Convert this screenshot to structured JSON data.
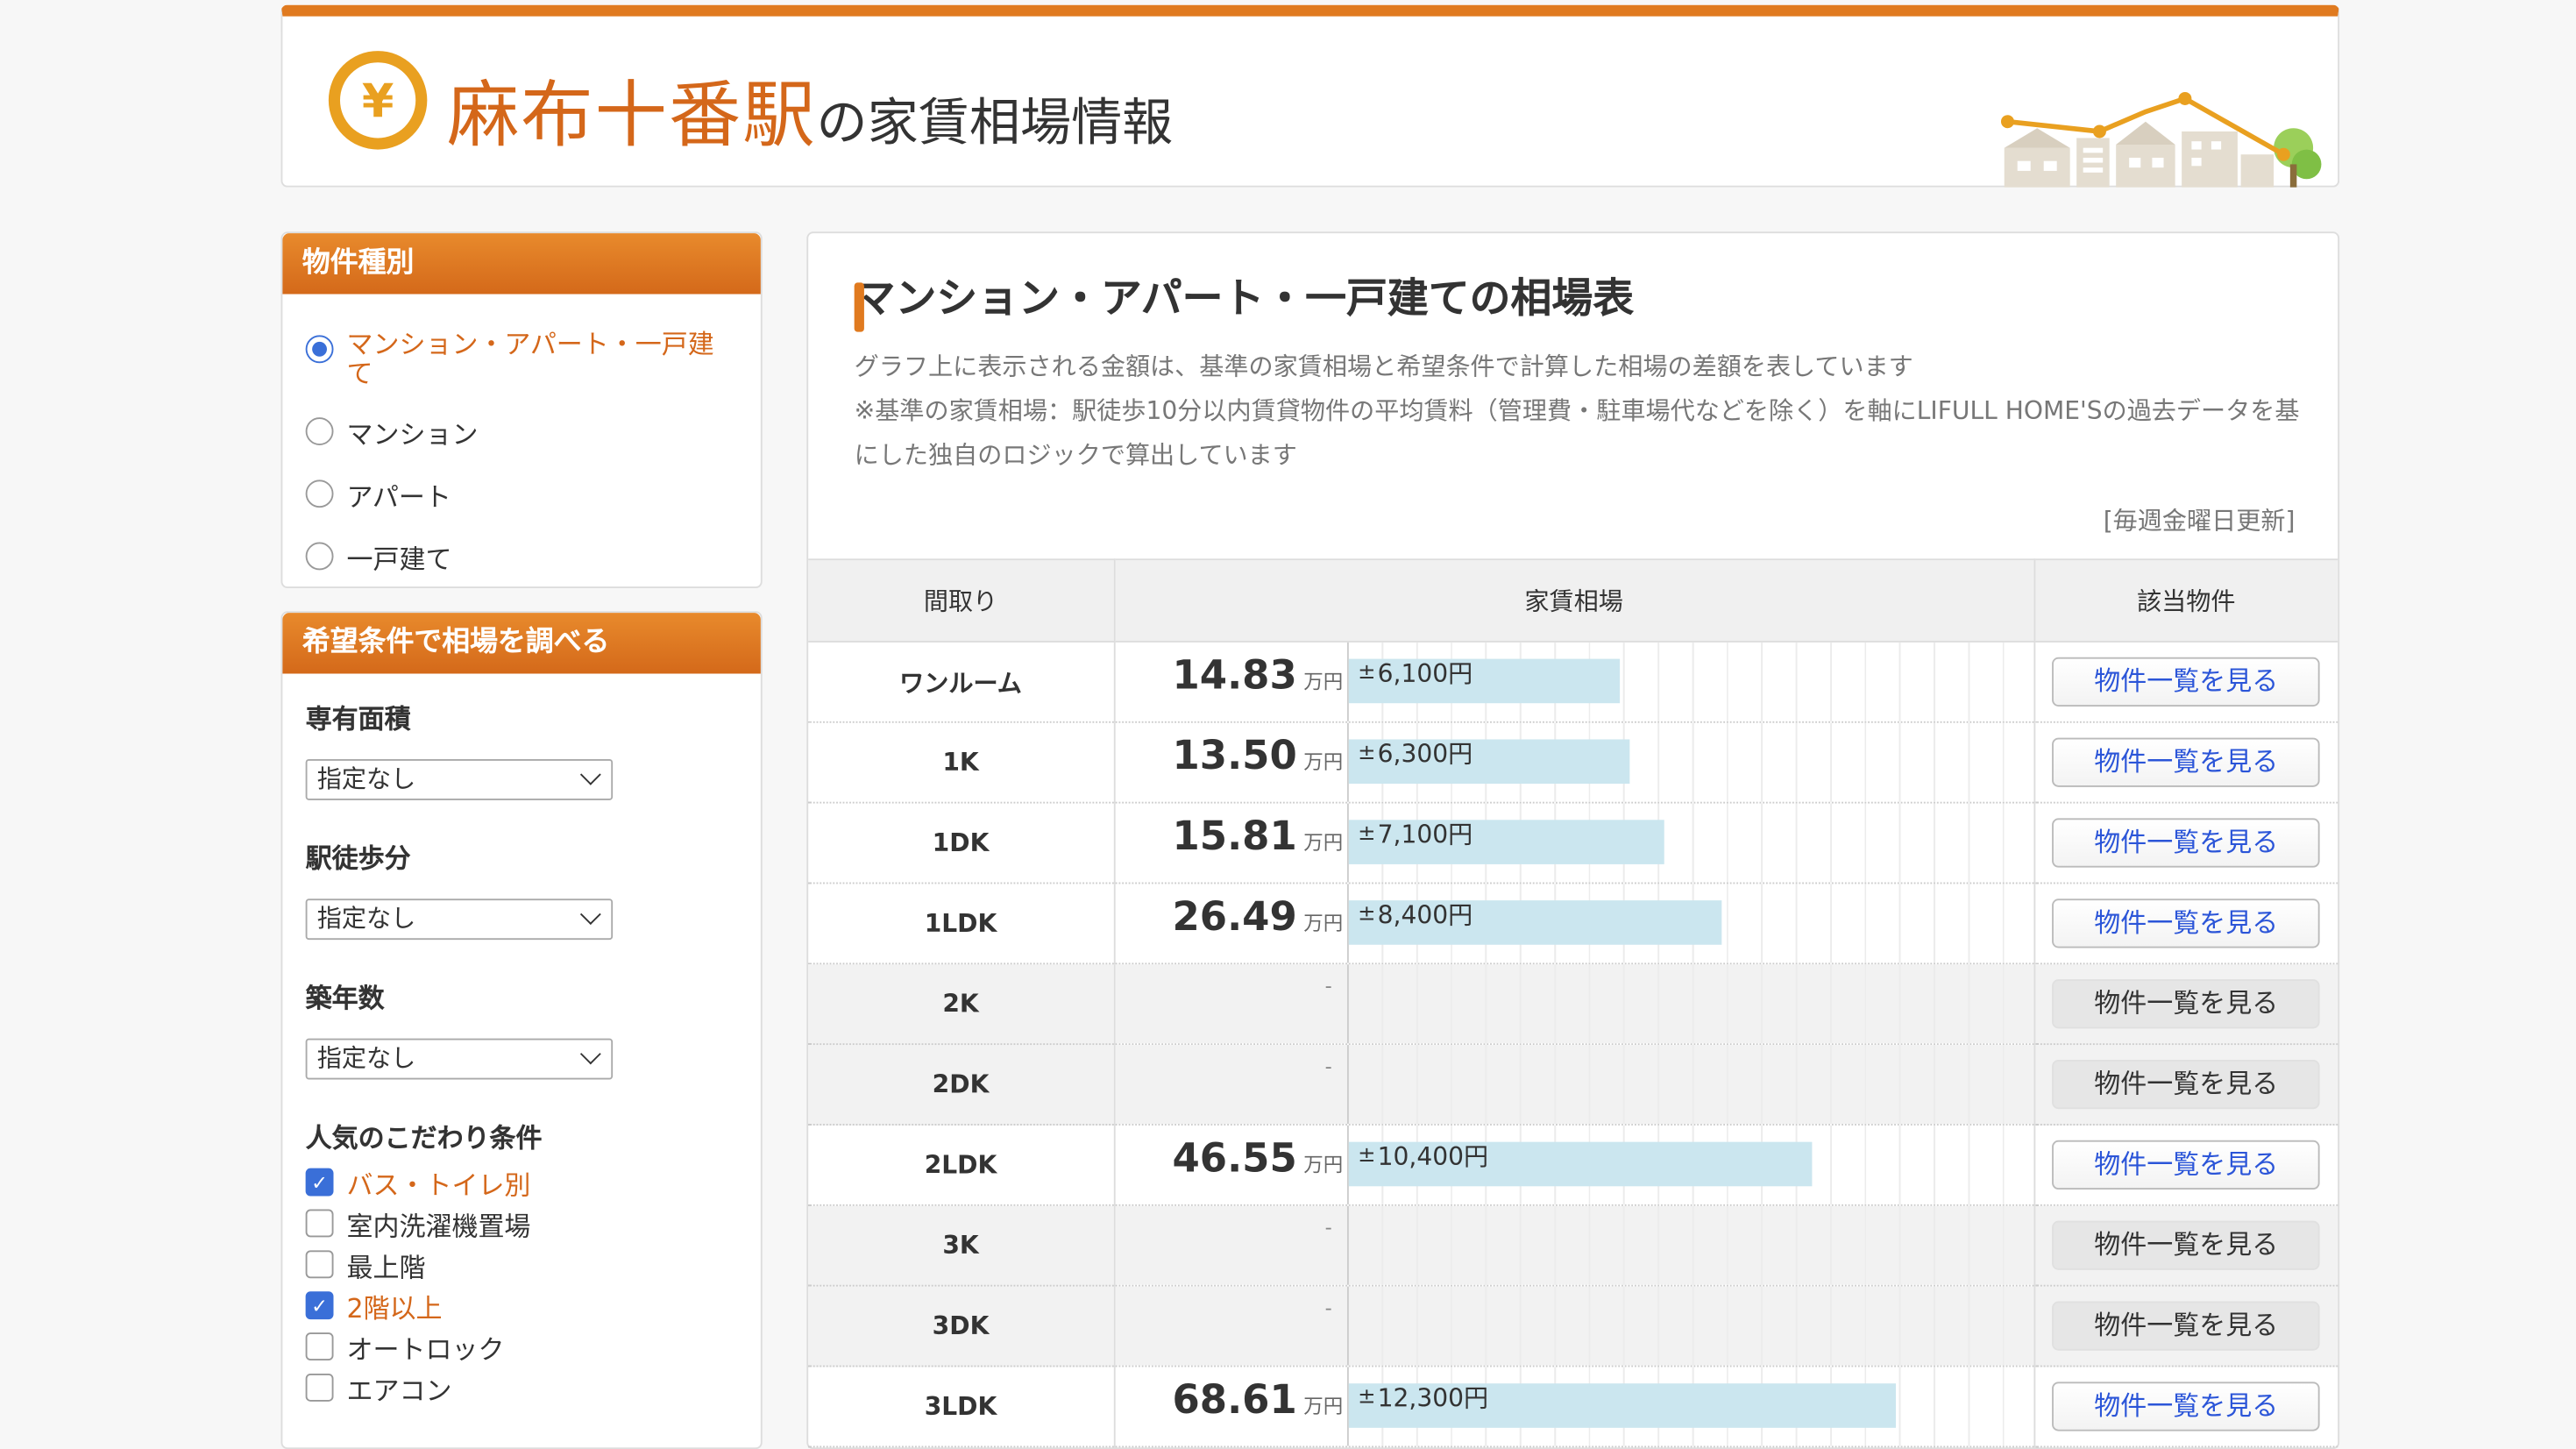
{
  "header": {
    "station": "麻布十番駅",
    "suffix": "の家賃相場情報",
    "logo_icon": "yen-coin-icon",
    "accent_color": "#e07a1f"
  },
  "property_type": {
    "heading": "物件種別",
    "options": [
      {
        "label": "マンション・アパート・一戸建て",
        "selected": true
      },
      {
        "label": "マンション",
        "selected": false
      },
      {
        "label": "アパート",
        "selected": false
      },
      {
        "label": "一戸建て",
        "selected": false
      }
    ]
  },
  "conditions": {
    "heading": "希望条件で相場を調べる",
    "area_label": "専有面積",
    "area_value": "指定なし",
    "walk_label": "駅徒歩分",
    "walk_value": "指定なし",
    "age_label": "築年数",
    "age_value": "指定なし",
    "popular_label": "人気のこだわり条件",
    "checks": [
      {
        "label": "バス・トイレ別",
        "checked": true
      },
      {
        "label": "室内洗濯機置場",
        "checked": false
      },
      {
        "label": "最上階",
        "checked": false
      },
      {
        "label": "2階以上",
        "checked": true
      },
      {
        "label": "オートロック",
        "checked": false
      },
      {
        "label": "エアコン",
        "checked": false
      }
    ]
  },
  "main": {
    "title": "マンション・アパート・一戸建ての相場表",
    "desc1": "グラフ上に表示される金額は、基準の家賃相場と希望条件で計算した相場の差額を表しています",
    "desc2": "※基準の家賃相場：駅徒歩10分以内賃貸物件の平均賃料（管理費・駐車場代などを除く）を軸にLIFULL HOME'Sの過去データを基にした独自のロジックで算出しています",
    "update": "[毎週金曜日更新]",
    "columns": [
      "間取り",
      "家賃相場",
      "該当物件"
    ],
    "price_unit": "万円",
    "button_label": "物件一覧を見る",
    "rows": [
      {
        "layout": "ワンルーム",
        "price": "14.83",
        "diff": "6,100円",
        "diff_value": 6100,
        "available": true
      },
      {
        "layout": "1K",
        "price": "13.50",
        "diff": "6,300円",
        "diff_value": 6300,
        "available": true
      },
      {
        "layout": "1DK",
        "price": "15.81",
        "diff": "7,100円",
        "diff_value": 7100,
        "available": true
      },
      {
        "layout": "1LDK",
        "price": "26.49",
        "diff": "8,400円",
        "diff_value": 8400,
        "available": true
      },
      {
        "layout": "2K",
        "price": "-",
        "diff": "",
        "diff_value": null,
        "available": false
      },
      {
        "layout": "2DK",
        "price": "-",
        "diff": "",
        "diff_value": null,
        "available": false
      },
      {
        "layout": "2LDK",
        "price": "46.55",
        "diff": "10,400円",
        "diff_value": 10400,
        "available": true
      },
      {
        "layout": "3K",
        "price": "-",
        "diff": "",
        "diff_value": null,
        "available": false
      },
      {
        "layout": "3DK",
        "price": "-",
        "diff": "",
        "diff_value": null,
        "available": false
      },
      {
        "layout": "3LDK",
        "price": "68.61",
        "diff": "12,300円",
        "diff_value": 12300,
        "available": true
      }
    ]
  }
}
